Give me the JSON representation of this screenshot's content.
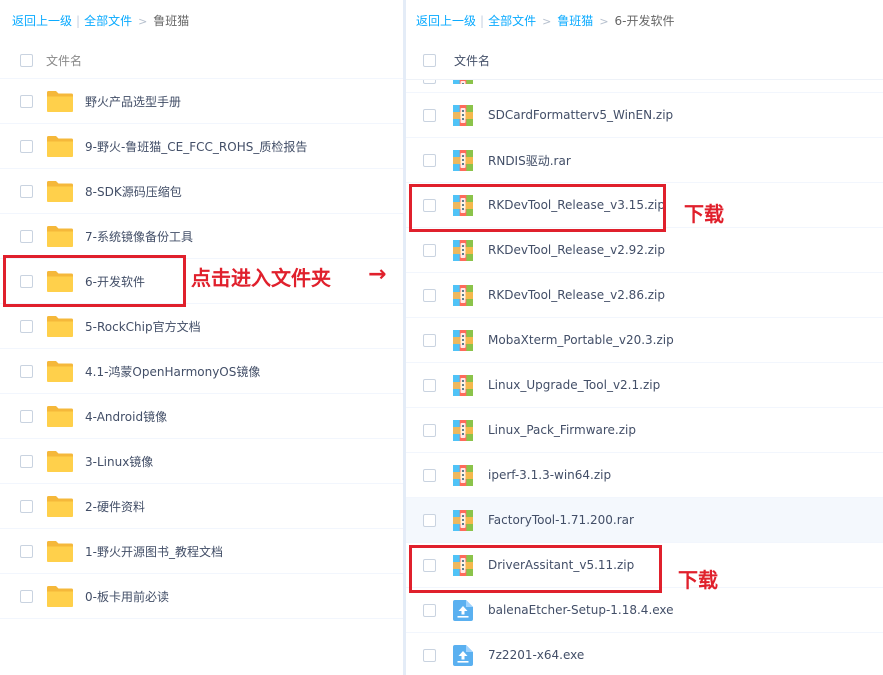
{
  "left_panel": {
    "breadcrumb": {
      "back": "返回上一级",
      "all": "全部文件",
      "current": "鲁班猫"
    },
    "header_label": "文件名",
    "items": [
      {
        "name": "野火产品选型手册"
      },
      {
        "name": "9-野火-鲁班猫_CE_FCC_ROHS_质检报告"
      },
      {
        "name": "8-SDK源码压缩包"
      },
      {
        "name": "7-系统镜像备份工具"
      },
      {
        "name": "6-开发软件"
      },
      {
        "name": "5-RockChip官方文档"
      },
      {
        "name": "4.1-鸿蒙OpenHarmonyOS镜像"
      },
      {
        "name": "4-Android镜像"
      },
      {
        "name": "3-Linux镜像"
      },
      {
        "name": "2-硬件资料"
      },
      {
        "name": "1-野火开源图书_教程文档"
      },
      {
        "name": "0-板卡用前必读"
      }
    ]
  },
  "right_panel": {
    "breadcrumb": {
      "back": "返回上一级",
      "all": "全部文件",
      "parent": "鲁班猫",
      "current": "6-开发软件"
    },
    "header_label": "文件名",
    "items": [
      {
        "name": "SDCardFormatterv5_WinEN.zip",
        "icon": "archive-icon"
      },
      {
        "name": "RNDIS驱动.rar",
        "icon": "archive-icon"
      },
      {
        "name": "RKDevTool_Release_v3.15.zip",
        "icon": "archive-icon"
      },
      {
        "name": "RKDevTool_Release_v2.92.zip",
        "icon": "archive-icon"
      },
      {
        "name": "RKDevTool_Release_v2.86.zip",
        "icon": "archive-icon"
      },
      {
        "name": "MobaXterm_Portable_v20.3.zip",
        "icon": "archive-icon"
      },
      {
        "name": "Linux_Upgrade_Tool_v2.1.zip",
        "icon": "archive-icon"
      },
      {
        "name": "Linux_Pack_Firmware.zip",
        "icon": "archive-icon"
      },
      {
        "name": "iperf-3.1.3-win64.zip",
        "icon": "archive-icon"
      },
      {
        "name": "FactoryTool-1.71.200.rar",
        "icon": "archive-icon"
      },
      {
        "name": "DriverAssitant_v5.11.zip",
        "icon": "archive-icon"
      },
      {
        "name": "balenaEtcher-Setup-1.18.4.exe",
        "icon": "exe-icon"
      },
      {
        "name": "7z2201-x64.exe",
        "icon": "exe-icon"
      }
    ]
  },
  "annotations": {
    "enter_folder": "点击进入文件夹",
    "arrow": "→",
    "download_1": "下载",
    "download_2": "下载"
  },
  "colors": {
    "link": "#09aaff",
    "annotation_red": "#e0202c",
    "folder_yellow": "#ffd04b"
  }
}
